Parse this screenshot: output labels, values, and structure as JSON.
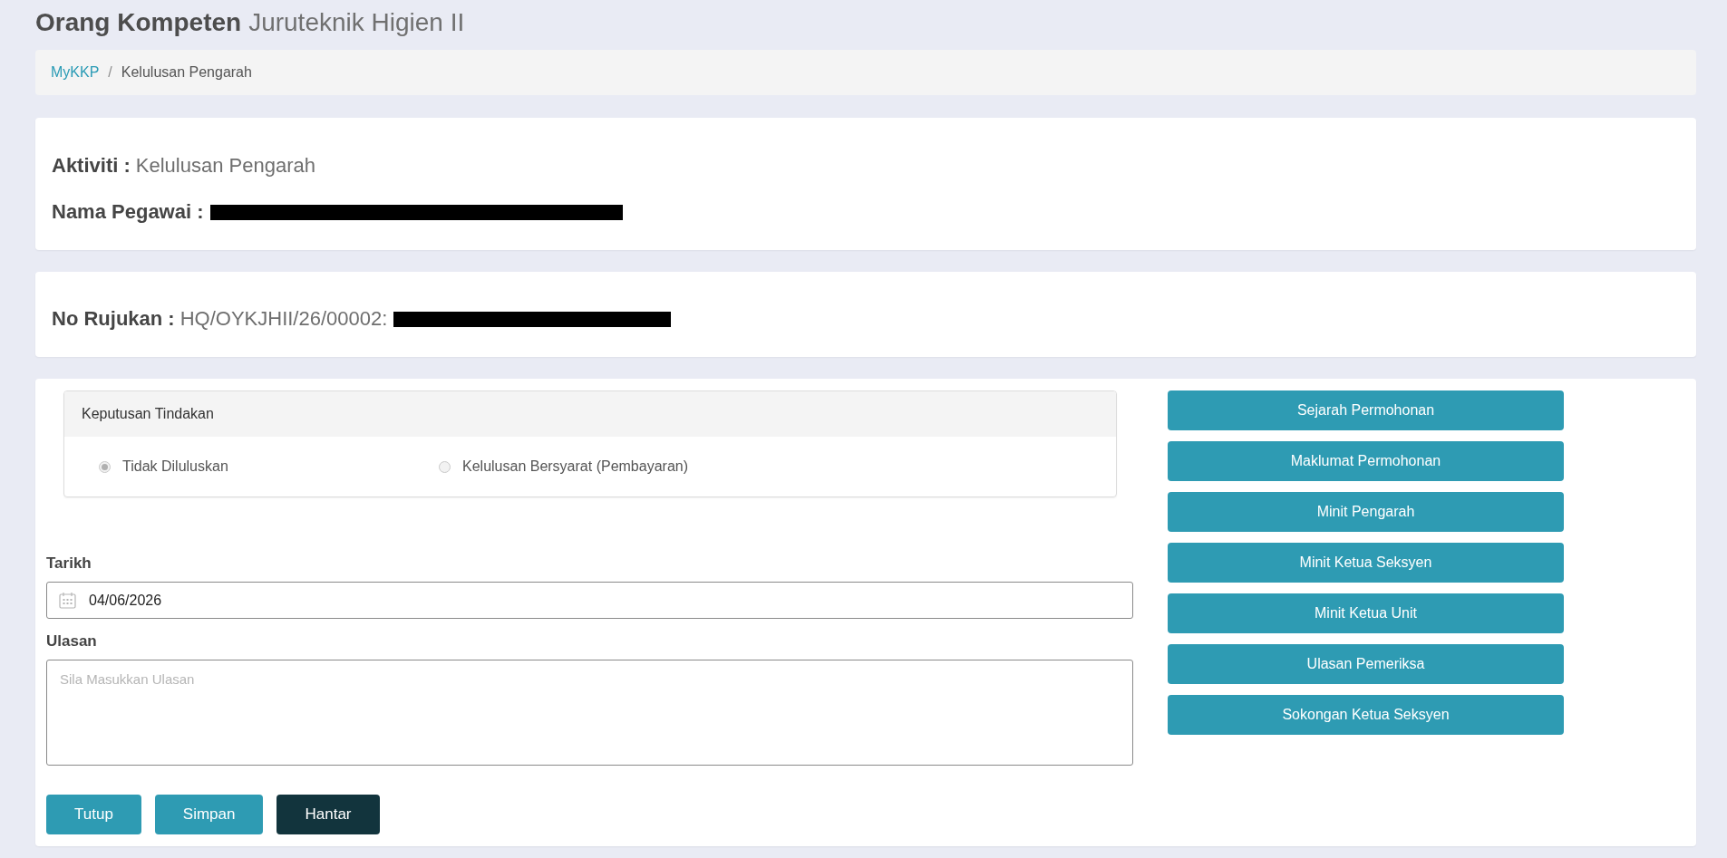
{
  "page_title": {
    "bold": "Orang Kompeten",
    "light": "Juruteknik Higien II"
  },
  "breadcrumb": {
    "separator": "/",
    "items": [
      {
        "label": "MyKKP",
        "kind": "link"
      },
      {
        "label": "Kelulusan Pengarah",
        "kind": "current"
      }
    ]
  },
  "info_card": {
    "fields": [
      {
        "label": "Aktiviti :",
        "value": "Kelulusan Pengarah"
      },
      {
        "label": "Nama Pegawai :",
        "redacted": true
      }
    ]
  },
  "reference_card": {
    "fields": [
      {
        "label": "No Rujukan :",
        "value": "HQ/OYKJHII/26/00002:",
        "redacted": true
      }
    ]
  },
  "decision_panel": {
    "title": "Keputusan Tindakan",
    "options": [
      {
        "label": "Tidak Diluluskan",
        "selected": true,
        "disabled": true
      },
      {
        "label": "Kelulusan Bersyarat (Pembayaran)",
        "selected": false,
        "disabled": true
      }
    ]
  },
  "form": {
    "date": {
      "label": "Tarikh",
      "value": "04/06/2026"
    },
    "remarks": {
      "label": "Ulasan",
      "placeholder": "Sila Masukkan Ulasan"
    }
  },
  "actions": [
    {
      "label": "Tutup",
      "kind": "default"
    },
    {
      "label": "Simpan",
      "kind": "default"
    },
    {
      "label": "Hantar",
      "kind": "primary"
    }
  ],
  "side_buttons": [
    {
      "label": "Sejarah Permohonan"
    },
    {
      "label": "Maklumat Permohonan"
    },
    {
      "label": "Minit Pengarah"
    },
    {
      "label": "Minit Ketua Seksyen"
    },
    {
      "label": "Minit Ketua Unit"
    },
    {
      "label": "Ulasan Pemeriksa"
    },
    {
      "label": "Sokongan Ketua Seksyen"
    }
  ]
}
